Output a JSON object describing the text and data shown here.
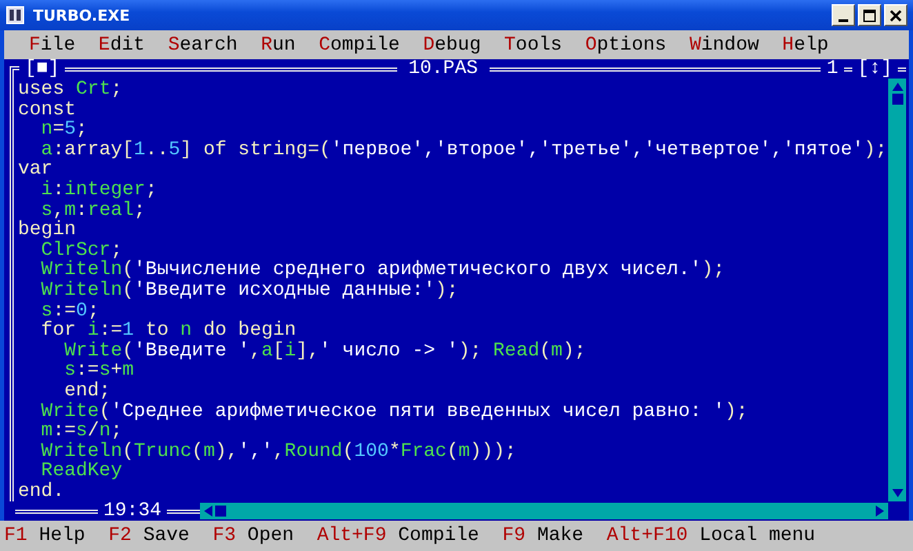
{
  "window": {
    "title": "TURBO.EXE"
  },
  "menu": [
    {
      "label": "File"
    },
    {
      "label": "Edit"
    },
    {
      "label": "Search"
    },
    {
      "label": "Run"
    },
    {
      "label": "Compile"
    },
    {
      "label": "Debug"
    },
    {
      "label": "Tools"
    },
    {
      "label": "Options"
    },
    {
      "label": "Window"
    },
    {
      "label": "Help"
    }
  ],
  "editor": {
    "close_box": "[■]",
    "title": "10.PAS",
    "window_number": "1",
    "zoom_box": "[↕]",
    "position": "19:34",
    "lines": [
      [
        {
          "kind": "plain",
          "text": "uses "
        },
        {
          "kind": "id",
          "text": "Crt"
        },
        {
          "kind": "plain",
          "text": ";"
        }
      ],
      [
        {
          "kind": "plain",
          "text": "const"
        }
      ],
      [
        {
          "kind": "id",
          "text": "  n"
        },
        {
          "kind": "plain",
          "text": "="
        },
        {
          "kind": "num",
          "text": "5"
        },
        {
          "kind": "plain",
          "text": ";"
        }
      ],
      [
        {
          "kind": "id",
          "text": "  a"
        },
        {
          "kind": "plain",
          "text": ":array["
        },
        {
          "kind": "num",
          "text": "1"
        },
        {
          "kind": "plain",
          "text": ".."
        },
        {
          "kind": "num",
          "text": "5"
        },
        {
          "kind": "plain",
          "text": "] of string=("
        },
        {
          "kind": "str",
          "text": "'первое','второе','третье','четвертое','пятое'"
        },
        {
          "kind": "plain",
          "text": ");"
        }
      ],
      [
        {
          "kind": "plain",
          "text": "var"
        }
      ],
      [
        {
          "kind": "id",
          "text": "  i"
        },
        {
          "kind": "plain",
          "text": ":"
        },
        {
          "kind": "id",
          "text": "integer"
        },
        {
          "kind": "plain",
          "text": ";"
        }
      ],
      [
        {
          "kind": "id",
          "text": "  s"
        },
        {
          "kind": "plain",
          "text": ","
        },
        {
          "kind": "id",
          "text": "m"
        },
        {
          "kind": "plain",
          "text": ":"
        },
        {
          "kind": "id",
          "text": "real"
        },
        {
          "kind": "plain",
          "text": ";"
        }
      ],
      [
        {
          "kind": "plain",
          "text": "begin"
        }
      ],
      [
        {
          "kind": "id",
          "text": "  ClrScr"
        },
        {
          "kind": "plain",
          "text": ";"
        }
      ],
      [
        {
          "kind": "id",
          "text": "  Writeln"
        },
        {
          "kind": "plain",
          "text": "("
        },
        {
          "kind": "str",
          "text": "'Вычисление среднего арифметического двух чисел.'"
        },
        {
          "kind": "plain",
          "text": ");"
        }
      ],
      [
        {
          "kind": "id",
          "text": "  Writeln"
        },
        {
          "kind": "plain",
          "text": "("
        },
        {
          "kind": "str",
          "text": "'Введите исходные данные:'"
        },
        {
          "kind": "plain",
          "text": ");"
        }
      ],
      [
        {
          "kind": "id",
          "text": "  s"
        },
        {
          "kind": "plain",
          "text": ":="
        },
        {
          "kind": "num",
          "text": "0"
        },
        {
          "kind": "plain",
          "text": ";"
        }
      ],
      [
        {
          "kind": "plain",
          "text": "  for "
        },
        {
          "kind": "id",
          "text": "i"
        },
        {
          "kind": "plain",
          "text": ":="
        },
        {
          "kind": "num",
          "text": "1"
        },
        {
          "kind": "plain",
          "text": " to "
        },
        {
          "kind": "id",
          "text": "n"
        },
        {
          "kind": "plain",
          "text": " do begin"
        }
      ],
      [
        {
          "kind": "id",
          "text": "    Write"
        },
        {
          "kind": "plain",
          "text": "("
        },
        {
          "kind": "str",
          "text": "'Введите '"
        },
        {
          "kind": "plain",
          "text": ","
        },
        {
          "kind": "id",
          "text": "a"
        },
        {
          "kind": "plain",
          "text": "["
        },
        {
          "kind": "id",
          "text": "i"
        },
        {
          "kind": "plain",
          "text": "],"
        },
        {
          "kind": "str",
          "text": "' число -> '"
        },
        {
          "kind": "plain",
          "text": "); "
        },
        {
          "kind": "id",
          "text": "Read"
        },
        {
          "kind": "plain",
          "text": "("
        },
        {
          "kind": "id",
          "text": "m"
        },
        {
          "kind": "plain",
          "text": ");"
        }
      ],
      [
        {
          "kind": "id",
          "text": "    s"
        },
        {
          "kind": "plain",
          "text": ":="
        },
        {
          "kind": "id",
          "text": "s"
        },
        {
          "kind": "plain",
          "text": "+"
        },
        {
          "kind": "id",
          "text": "m"
        }
      ],
      [
        {
          "kind": "plain",
          "text": "    end;"
        }
      ],
      [
        {
          "kind": "id",
          "text": "  Write"
        },
        {
          "kind": "plain",
          "text": "("
        },
        {
          "kind": "str",
          "text": "'Среднее арифметическое пяти введенных чисел равно: '"
        },
        {
          "kind": "plain",
          "text": ");"
        }
      ],
      [
        {
          "kind": "id",
          "text": "  m"
        },
        {
          "kind": "plain",
          "text": ":="
        },
        {
          "kind": "id",
          "text": "s"
        },
        {
          "kind": "plain",
          "text": "/"
        },
        {
          "kind": "id",
          "text": "n"
        },
        {
          "kind": "plain",
          "text": ";"
        }
      ],
      [
        {
          "kind": "id",
          "text": "  Writeln"
        },
        {
          "kind": "plain",
          "text": "("
        },
        {
          "kind": "id",
          "text": "Trunc"
        },
        {
          "kind": "plain",
          "text": "("
        },
        {
          "kind": "id",
          "text": "m"
        },
        {
          "kind": "plain",
          "text": "),"
        },
        {
          "kind": "str",
          "text": "','"
        },
        {
          "kind": "plain",
          "text": ","
        },
        {
          "kind": "id",
          "text": "Round"
        },
        {
          "kind": "plain",
          "text": "("
        },
        {
          "kind": "num",
          "text": "100"
        },
        {
          "kind": "plain",
          "text": "*"
        },
        {
          "kind": "id",
          "text": "Frac"
        },
        {
          "kind": "plain",
          "text": "("
        },
        {
          "kind": "id",
          "text": "m"
        },
        {
          "kind": "plain",
          "text": ")));"
        }
      ],
      [
        {
          "kind": "id",
          "text": "  ReadKey"
        }
      ],
      [
        {
          "kind": "plain",
          "text": "end."
        }
      ]
    ]
  },
  "status_bar": [
    {
      "key": "F1",
      "label": "Help"
    },
    {
      "key": "F2",
      "label": "Save"
    },
    {
      "key": "F3",
      "label": "Open"
    },
    {
      "key": "Alt+F9",
      "label": "Compile"
    },
    {
      "key": "F9",
      "label": "Make"
    },
    {
      "key": "Alt+F10",
      "label": "Local menu"
    }
  ]
}
